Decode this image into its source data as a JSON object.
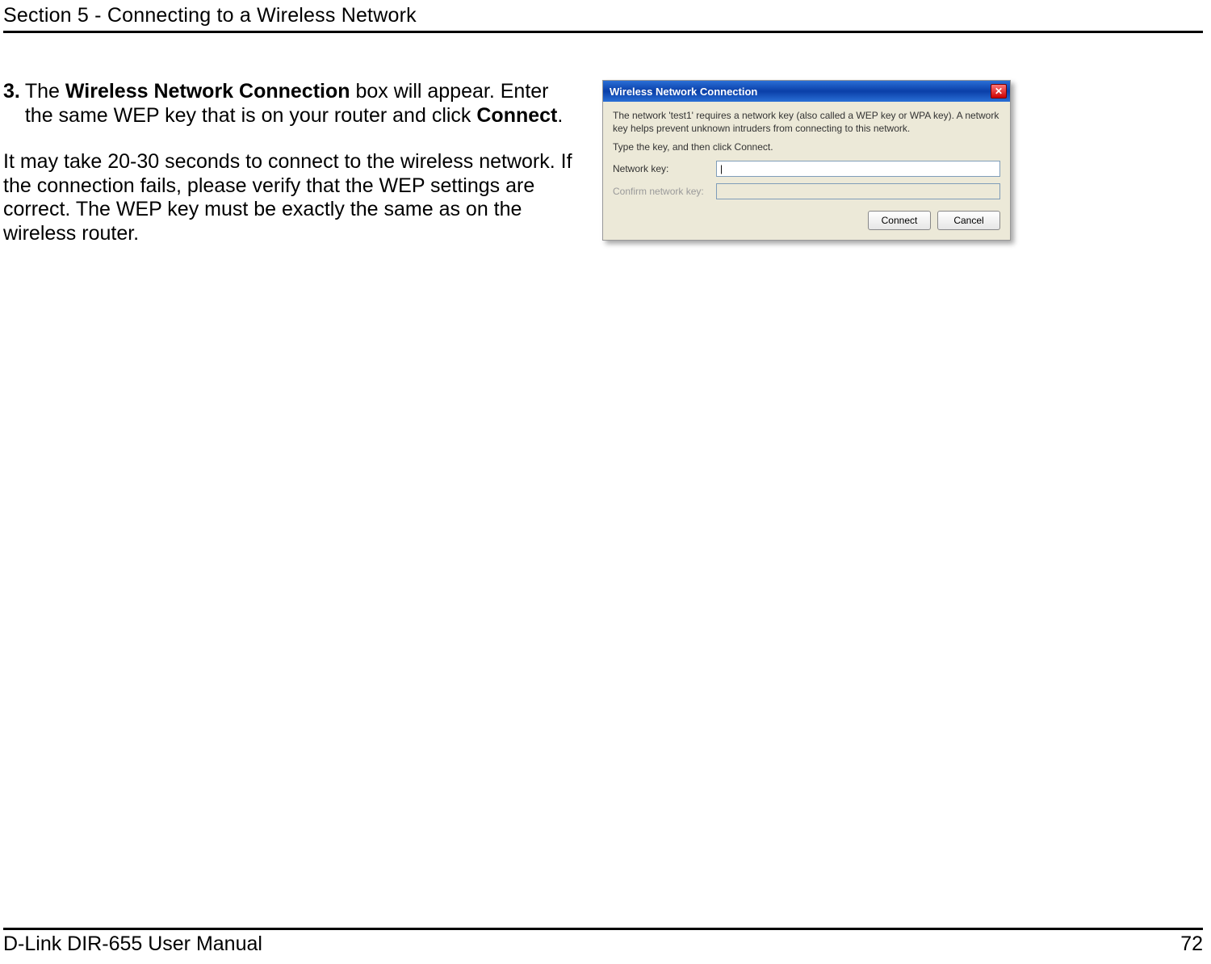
{
  "header": {
    "section_title": "Section 5 - Connecting to a Wireless Network"
  },
  "step": {
    "number": "3.",
    "body_prefix": " The ",
    "bold1": "Wireless Network Connection",
    "body_mid": " box will appear. Enter the same WEP key that is on your router and click ",
    "bold2": "Connect",
    "body_suffix": "."
  },
  "paragraph2": "It may take 20-30 seconds to connect to the wireless network. If the connection fails, please verify that the WEP settings are correct. The WEP key must be exactly the same as on the wireless router.",
  "dialog": {
    "title": "Wireless Network Connection",
    "close_glyph": "✕",
    "info1": "The network 'test1' requires a network key (also called a WEP key or WPA key). A network key helps prevent unknown intruders from connecting to this network.",
    "info2": "Type the key, and then click Connect.",
    "label_key": "Network key:",
    "label_confirm": "Confirm network key:",
    "input_value": "|",
    "confirm_value": "",
    "btn_connect": "Connect",
    "btn_cancel": "Cancel"
  },
  "footer": {
    "manual": "D-Link DIR-655 User Manual",
    "page": "72"
  }
}
